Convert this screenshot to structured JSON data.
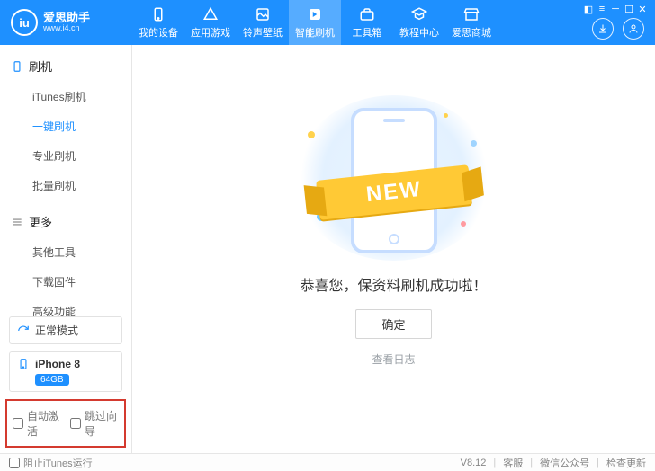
{
  "brand": {
    "logo_text": "iu",
    "name": "爱思助手",
    "site": "www.i4.cn"
  },
  "topnav": [
    {
      "label": "我的设备"
    },
    {
      "label": "应用游戏"
    },
    {
      "label": "铃声壁纸"
    },
    {
      "label": "智能刷机",
      "active": true
    },
    {
      "label": "工具箱"
    },
    {
      "label": "教程中心"
    },
    {
      "label": "爱思商城"
    }
  ],
  "sidebar": {
    "groups": [
      {
        "title": "刷机",
        "items": [
          {
            "label": "iTunes刷机"
          },
          {
            "label": "一键刷机",
            "active": true
          },
          {
            "label": "专业刷机"
          },
          {
            "label": "批量刷机"
          }
        ]
      },
      {
        "title": "更多",
        "items": [
          {
            "label": "其他工具"
          },
          {
            "label": "下载固件"
          },
          {
            "label": "高级功能"
          }
        ]
      }
    ],
    "mode_label": "正常模式",
    "device": {
      "name": "iPhone 8",
      "storage": "64GB"
    },
    "checkboxes": {
      "auto_activate": "自动激活",
      "skip_setup": "跳过向导"
    }
  },
  "main": {
    "ribbon_text": "NEW",
    "success_msg": "恭喜您，保资料刷机成功啦！",
    "ok_button": "确定",
    "view_log": "查看日志"
  },
  "statusbar": {
    "block_itunes": "阻止iTunes运行",
    "version": "V8.12",
    "support": "客服",
    "wechat": "微信公众号",
    "check_update": "检查更新"
  }
}
